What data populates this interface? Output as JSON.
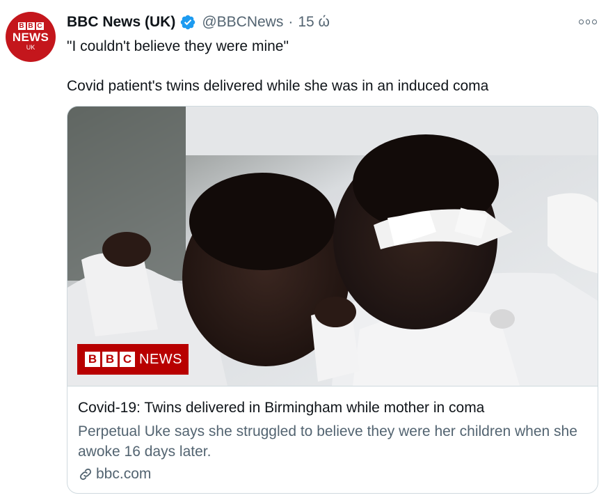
{
  "account": {
    "display_name": "BBC News (UK)",
    "handle": "@BBCNews",
    "separator": "·",
    "time": "15 ώ",
    "verified": true,
    "avatar": {
      "bbc_letters": [
        "B",
        "B",
        "C"
      ],
      "news": "NEWS",
      "uk": "UK",
      "color": "#c4161c"
    }
  },
  "tweet": {
    "line1": "\"I couldn't believe they were mine\"",
    "line2": "Covid patient's twins delivered while she was in an induced coma"
  },
  "card": {
    "image_logo": {
      "letters": [
        "B",
        "B",
        "C"
      ],
      "news": "NEWS"
    },
    "title": "Covid-19: Twins delivered in Birmingham while mother in coma",
    "description": "Perpetual Uke says she struggled to believe they were her children when she awoke 16 days later.",
    "domain": "bbc.com"
  },
  "colors": {
    "verified": "#1d9bf0",
    "secondary_text": "#536471",
    "bbc_red": "#b80000"
  },
  "icons": {
    "verified": "verified-badge-icon",
    "more": "more-options-icon",
    "link": "link-icon"
  }
}
